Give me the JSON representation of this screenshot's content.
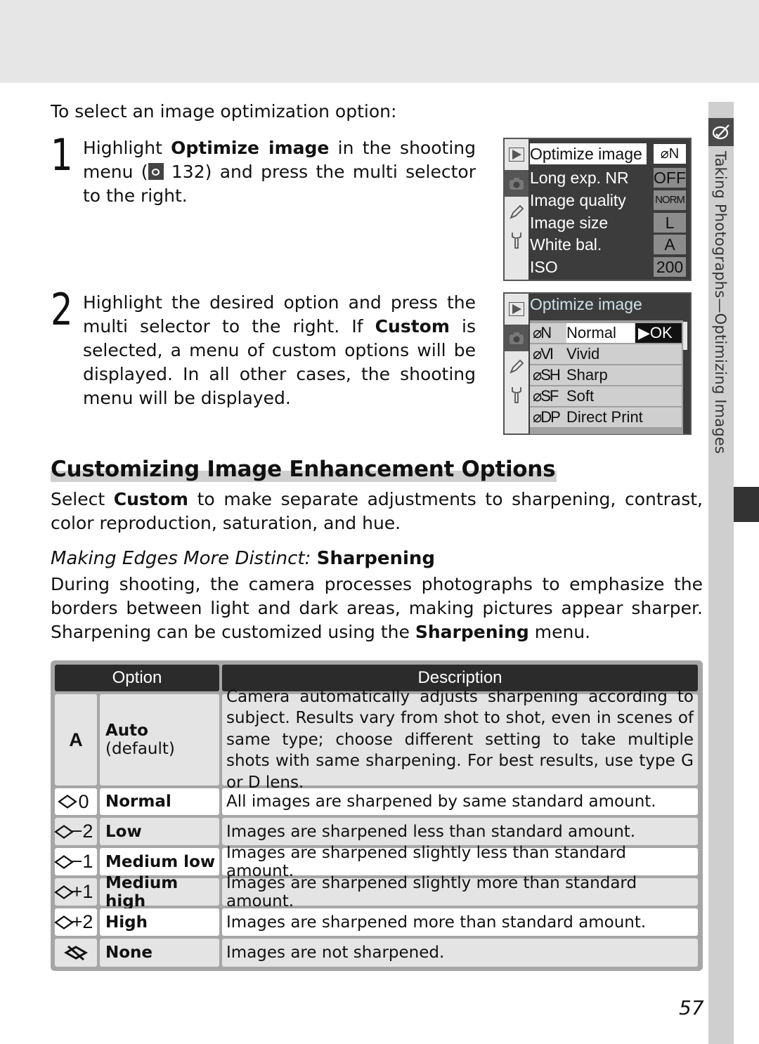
{
  "page": {
    "intro": "To select an image optimization option:",
    "page_number": "57",
    "side_tab_text": "Taking Photographs—Optimizing Images",
    "side_tab_icon": "optimize-image-palette-icon"
  },
  "steps": [
    {
      "number": "1",
      "text_before": "Highlight ",
      "bold": "Optimize image",
      "text_middle": " in the shooting menu (",
      "ref_icon": "reference-eye-icon",
      "ref_page": " 132) and press the multi selector to the right."
    },
    {
      "number": "2",
      "text_before": "Highlight the desired option and press the multi selector to the right.  If ",
      "bold": "Custom",
      "text_after": " is selected, a menu of custom options will be displayed.  In all other cases, the shooting menu will be displayed."
    }
  ],
  "camera_screen_1": {
    "tabs": [
      "playback-icon",
      "camera-icon",
      "pencil-icon",
      "wrench-icon"
    ],
    "rows": [
      {
        "label": "Optimize image",
        "value": "⌀N"
      },
      {
        "label": "Long exp. NR",
        "value": "OFF"
      },
      {
        "label": "Image quality",
        "value": "NORM"
      },
      {
        "label": "Image size",
        "value": "L"
      },
      {
        "label": "White bal.",
        "value": "A"
      },
      {
        "label": "ISO",
        "value": "200"
      }
    ]
  },
  "camera_screen_2": {
    "title": "Optimize image",
    "rows": [
      {
        "code": "⌀N",
        "name": "Normal",
        "action": "▶OK"
      },
      {
        "code": "⌀VI",
        "name": "Vivid"
      },
      {
        "code": "⌀SH",
        "name": "Sharp"
      },
      {
        "code": "⌀SF",
        "name": "Soft"
      },
      {
        "code": "⌀DP",
        "name": "Direct Print"
      }
    ]
  },
  "section": {
    "title": "Customizing Image Enhancement Options",
    "intro_before": "Select ",
    "intro_bold": "Custom",
    "intro_after": " to make separate adjustments to sharpening, contrast, color reproduction, saturation, and hue.",
    "subhead_italic": "Making Edges More Distinct: ",
    "subhead_bold": "Sharpening",
    "body_before": "During shooting, the camera processes photographs to emphasize the borders between light and dark areas, making pictures appear sharper.  Sharpening can be customized using the ",
    "body_bold": "Sharpening",
    "body_after": " menu."
  },
  "table": {
    "headers": [
      "Option",
      "Description"
    ],
    "rows": [
      {
        "symbol": "A",
        "option": "Auto",
        "option_note": "(default)",
        "description": "Camera automatically adjusts sharpening according to subject.  Results vary from shot to shot, even in scenes of same type; choose different setting to take multiple shots with same sharpening.  For best results, use type G or D lens."
      },
      {
        "symbol": "0",
        "option": "Normal",
        "description": "All images are sharpened by same standard amount."
      },
      {
        "symbol": "−2",
        "option": "Low",
        "description": "Images are sharpened less than standard amount."
      },
      {
        "symbol": "−1",
        "option": "Medium low",
        "description": "Images are sharpened slightly less than standard amount."
      },
      {
        "symbol": "+1",
        "option": "Medium high",
        "description": "Images are sharpened slightly more than standard amount."
      },
      {
        "symbol": "+2",
        "option": "High",
        "description": "Images are sharpened more than standard amount."
      },
      {
        "symbol": "none",
        "option": "None",
        "description": "Images are not sharpened."
      }
    ]
  }
}
